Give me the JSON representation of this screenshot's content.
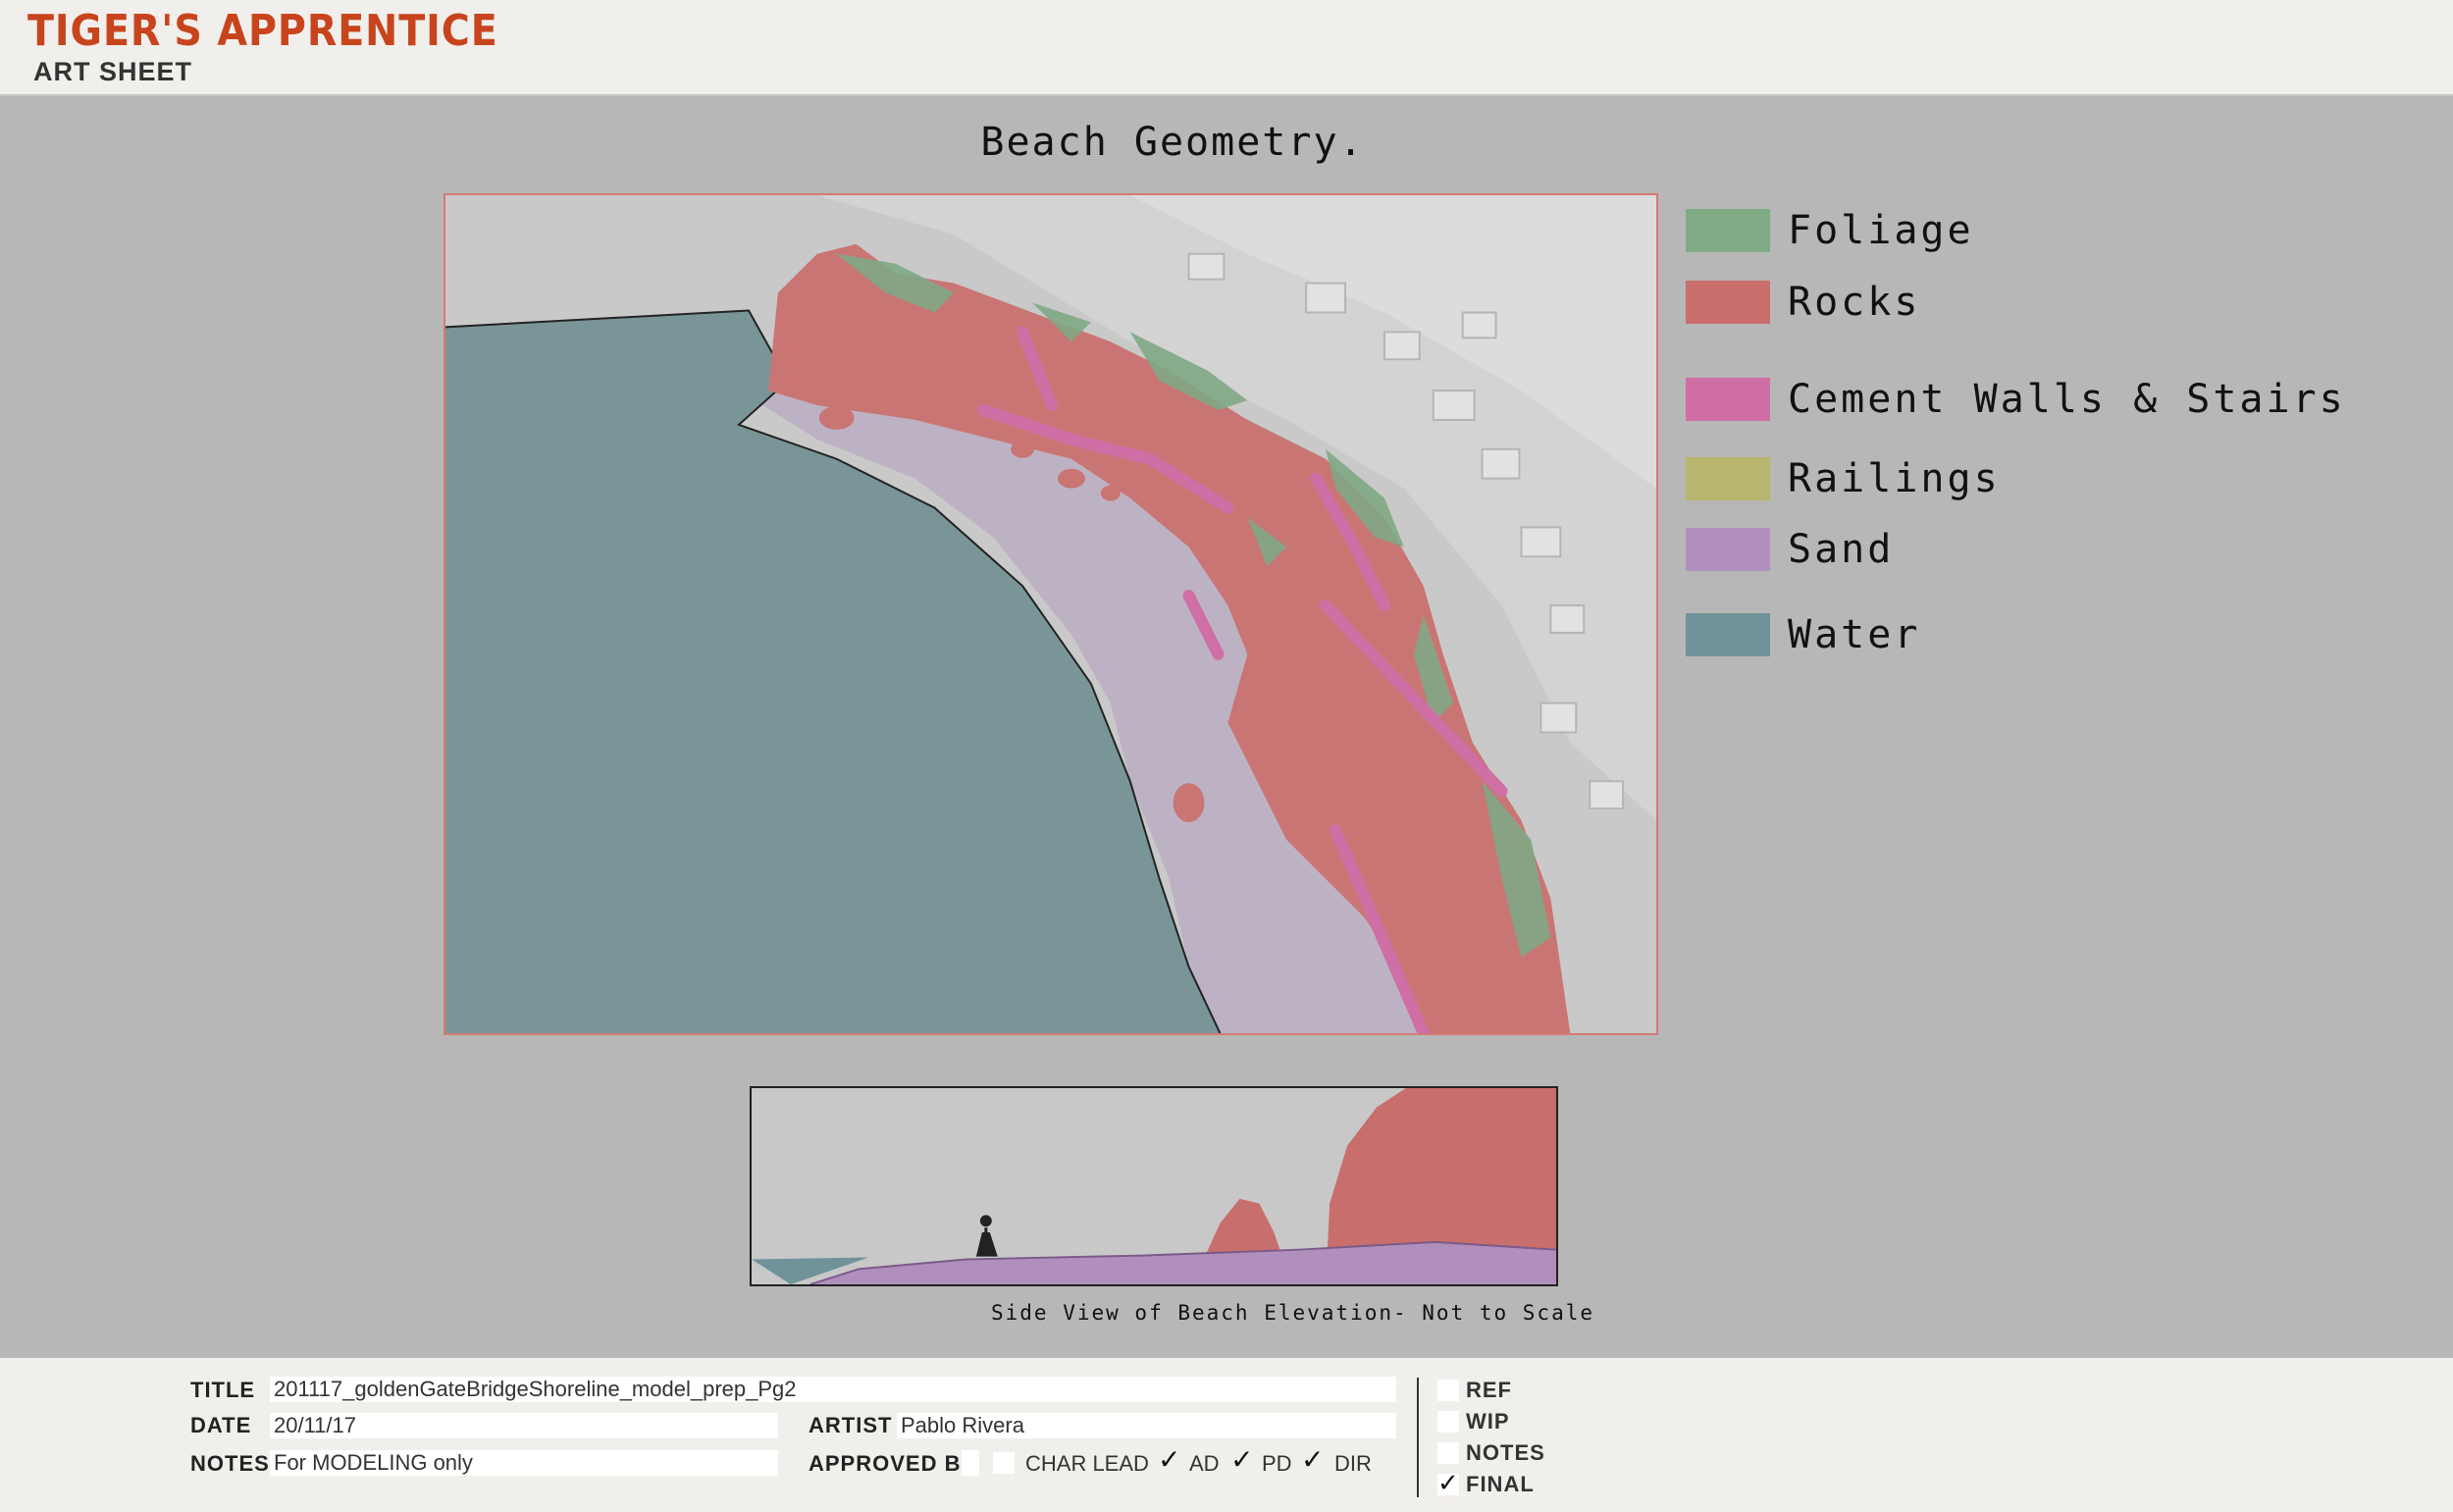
{
  "header": {
    "brand": "TIGER'S APPRENTICE",
    "subtitle": "ART SHEET"
  },
  "sheet": {
    "title": "Beach Geometry.",
    "side_view_caption": "Side View of Beach Elevation- Not to Scale"
  },
  "legend": [
    {
      "label": "Foliage",
      "color": "#7fab84"
    },
    {
      "label": "Rocks",
      "color": "#c86e6c"
    },
    {
      "label": "Cement Walls & Stairs",
      "color": "#cf6fa6"
    },
    {
      "label": "Railings",
      "color": "#b7b56e"
    },
    {
      "label": "Sand",
      "color": "#b08fbd"
    },
    {
      "label": "Water",
      "color": "#6f9398"
    }
  ],
  "colors": {
    "brand": "#c8441d",
    "map_border": "#d47b74",
    "page_bg": "#b7b7b7",
    "header_bg": "#f1efeb"
  },
  "footer": {
    "title_label": "TITLE",
    "title_value": "201117_goldenGateBridgeShoreline_model_prep_Pg2",
    "date_label": "DATE",
    "date_value": "20/11/17",
    "artist_label": "ARTIST",
    "artist_value": "Pablo Rivera",
    "notes_label": "NOTES",
    "notes_value": "For MODELING only",
    "approved_label": "APPROVED BY",
    "approvers": [
      {
        "label": "CHAR LEAD",
        "checked": false
      },
      {
        "label": "AD",
        "checked": true
      },
      {
        "label": "PD",
        "checked": true
      },
      {
        "label": "DIR",
        "checked": true
      }
    ],
    "statuses": [
      {
        "label": "REF",
        "checked": false
      },
      {
        "label": "WIP",
        "checked": false
      },
      {
        "label": "NOTES",
        "checked": false
      },
      {
        "label": "FINAL",
        "checked": true
      }
    ],
    "check_glyph": "✓"
  }
}
